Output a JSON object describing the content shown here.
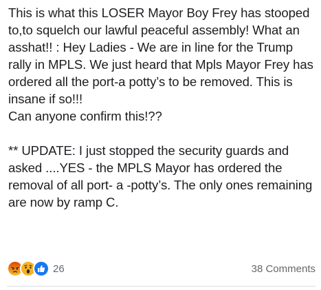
{
  "post": {
    "paragraphs": [
      "This is what this LOSER Mayor Boy Frey has stooped to,to squelch our lawful peaceful assembly! What an asshat!! : Hey Ladies - We are in line for the Trump rally in MPLS. We just heard that Mpls Mayor Frey has ordered all the port-a potty’s to be removed. This is insane if so!!!",
      "Can anyone confirm this!??",
      "** UPDATE: I just stopped the security guards and asked ....YES - the MPLS Mayor has ordered the removal of all port- a -potty’s. The only ones remaining are now by ramp C."
    ]
  },
  "footer": {
    "reaction_icons": [
      "angry-react-icon",
      "wow-react-icon",
      "like-react-icon"
    ],
    "reaction_count": "26",
    "comments_label": "38 Comments"
  },
  "colors": {
    "text": "#1c1e21",
    "secondary": "#65676b",
    "like_blue": "#1877f2",
    "angry_orange": "#e9710f",
    "wow_yellow": "#f7b125"
  }
}
